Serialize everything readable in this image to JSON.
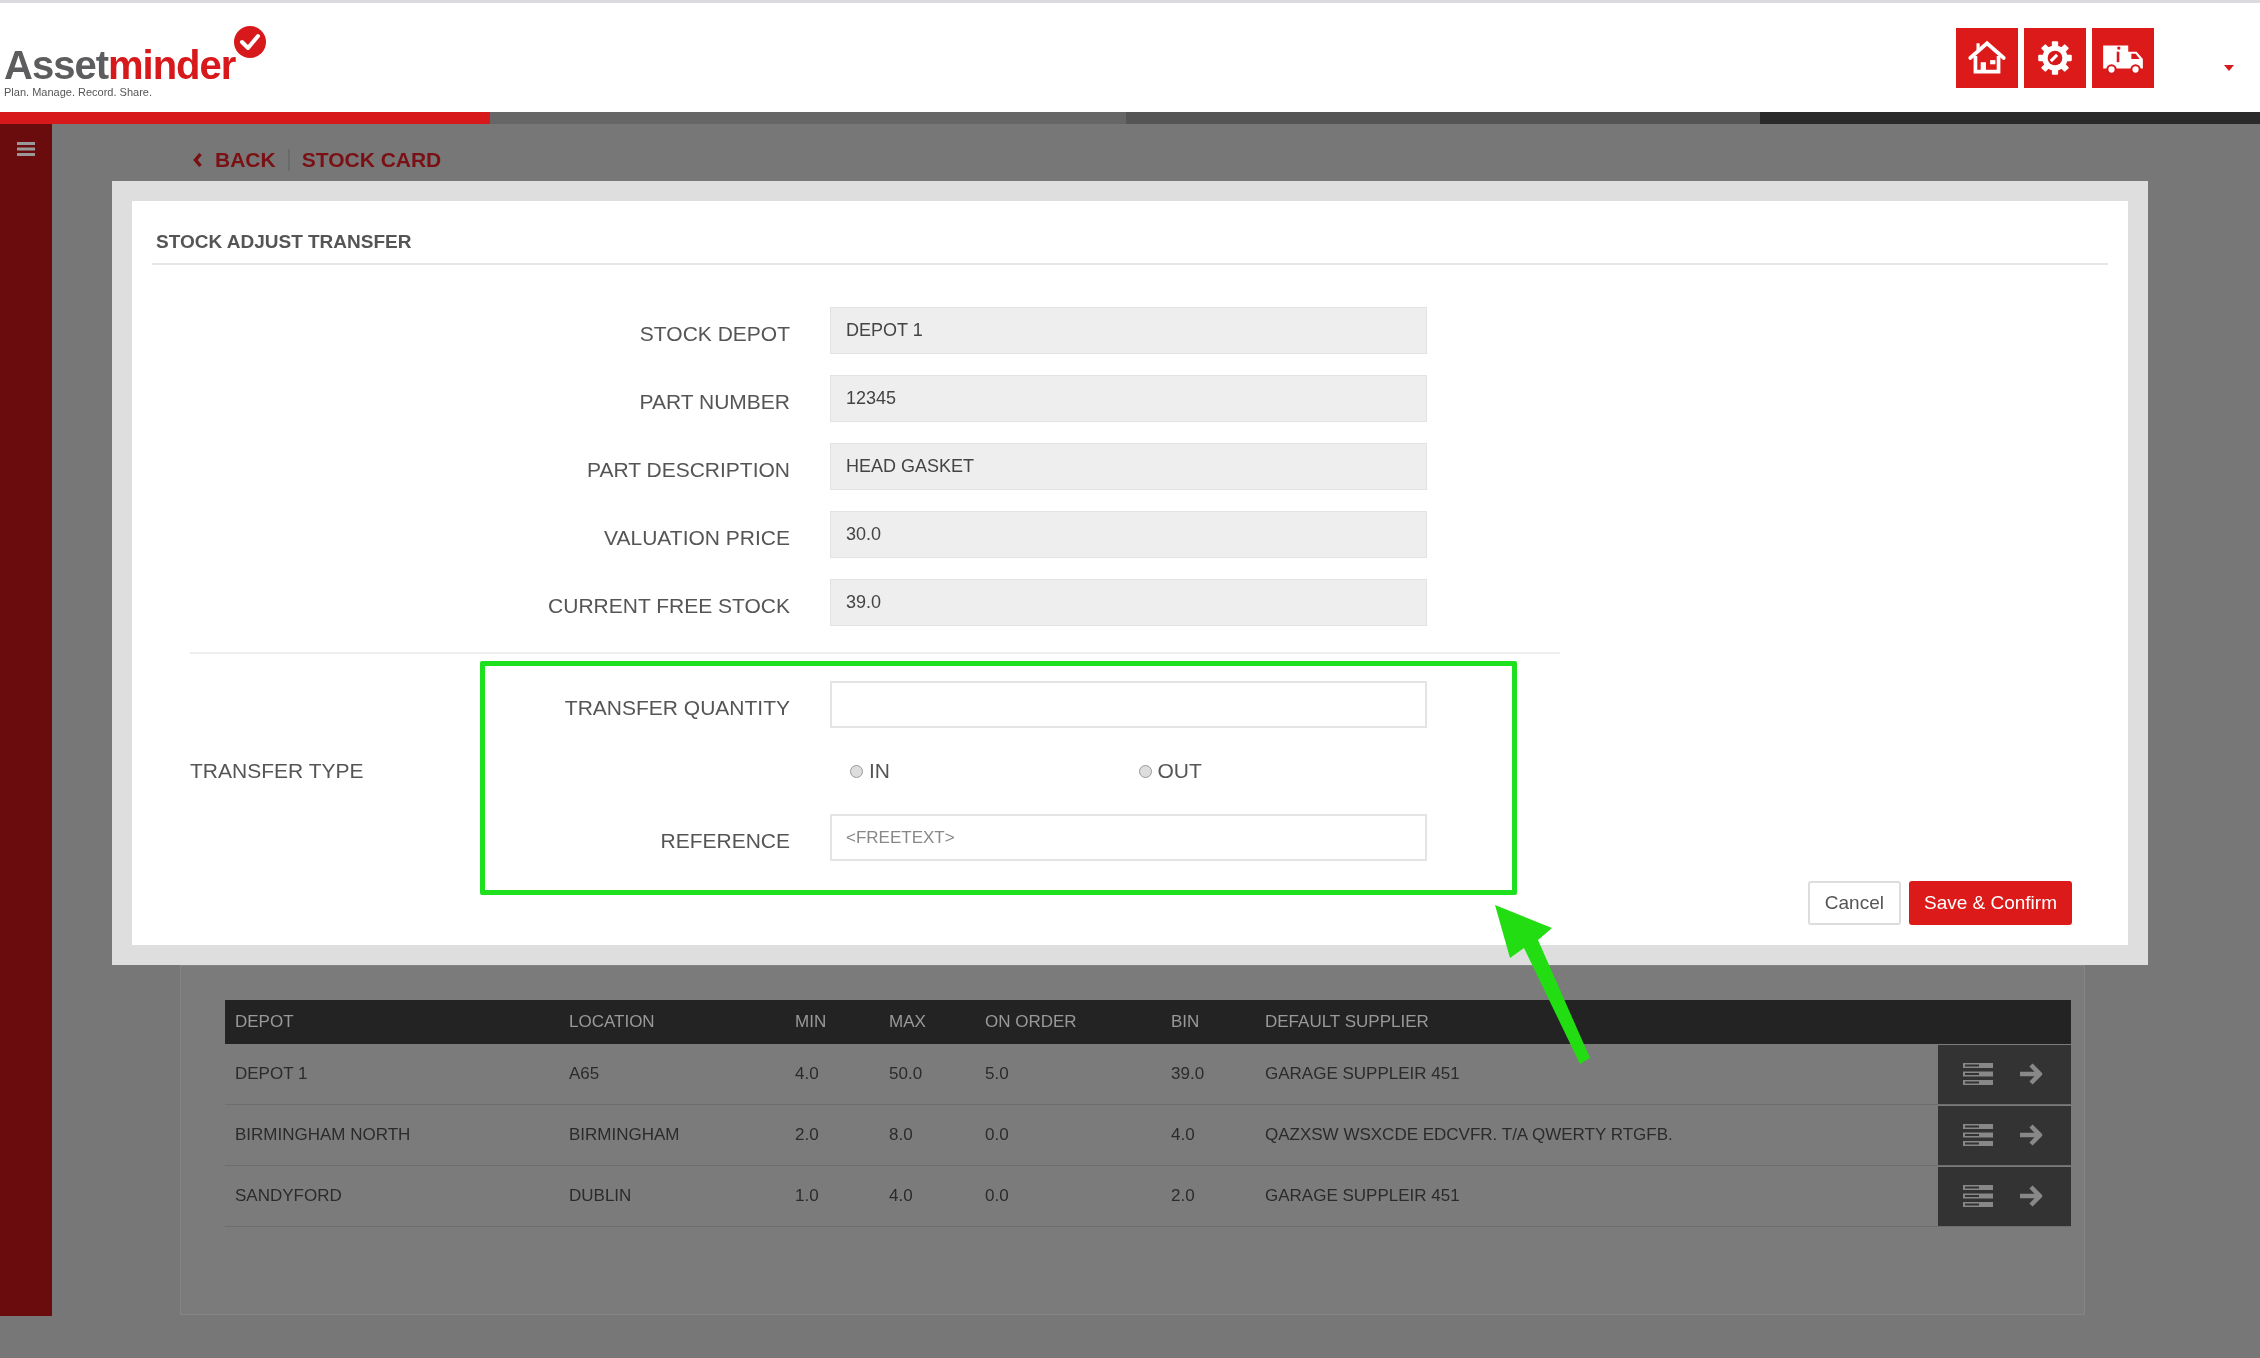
{
  "header": {
    "logo": {
      "name_start": "Asset",
      "name_end": "minder",
      "tagline": "Plan. Manage. Record. Share."
    }
  },
  "breadcrumb": {
    "back": "BACK",
    "current": "STOCK CARD"
  },
  "dialog": {
    "title": "STOCK ADJUST TRANSFER",
    "fields": [
      {
        "label": "STOCK DEPOT",
        "value": "DEPOT 1"
      },
      {
        "label": "PART NUMBER",
        "value": "12345"
      },
      {
        "label": "PART DESCRIPTION",
        "value": "HEAD GASKET"
      },
      {
        "label": "VALUATION PRICE",
        "value": "30.0"
      },
      {
        "label": "CURRENT FREE STOCK",
        "value": "39.0"
      }
    ],
    "transfer_type_label": "TRANSFER TYPE",
    "quantity": {
      "label": "TRANSFER QUANTITY"
    },
    "options": [
      {
        "label": "IN",
        "selected": false
      },
      {
        "label": "OUT",
        "selected": false
      }
    ],
    "reference": {
      "label": "REFERENCE",
      "placeholder": "<FREETEXT>"
    },
    "buttons": {
      "cancel": "Cancel",
      "save": "Save & Confirm"
    }
  },
  "table": {
    "columns": [
      "DEPOT",
      "LOCATION",
      "MIN",
      "MAX",
      "ON ORDER",
      "BIN",
      "DEFAULT SUPPLIER"
    ],
    "rows": [
      [
        "DEPOT 1",
        "A65",
        "4.0",
        "50.0",
        "5.0",
        "39.0",
        "GARAGE SUPPLEIR 451"
      ],
      [
        "BIRMINGHAM NORTH",
        "BIRMINGHAM",
        "2.0",
        "8.0",
        "0.0",
        "4.0",
        "QAZXSW WSXCDE EDCVFR. T/A QWERTY RTGFB."
      ],
      [
        "SANDYFORD",
        "DUBLIN",
        "1.0",
        "4.0",
        "0.0",
        "2.0",
        "GARAGE SUPPLEIR 451"
      ]
    ]
  }
}
